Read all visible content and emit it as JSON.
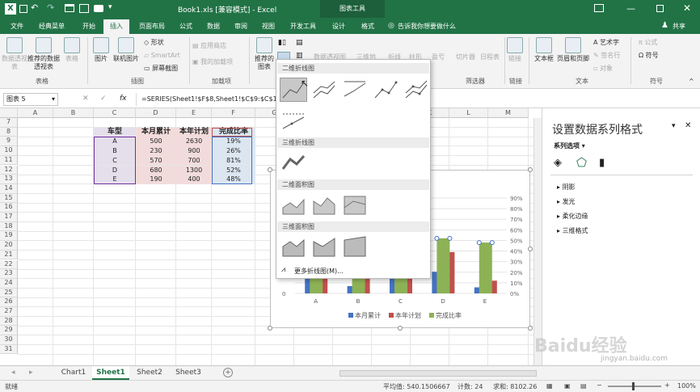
{
  "titlebar": {
    "title": "Book1.xls [兼容模式] - Excel",
    "context_tool": "图表工具"
  },
  "tabs": [
    "文件",
    "经典菜单",
    "开始",
    "插入",
    "页面布局",
    "公式",
    "数据",
    "审阅",
    "视图",
    "开发工具",
    "设计",
    "格式"
  ],
  "tell_me": "告诉我你想要做什么",
  "share": "共享",
  "ribbon": {
    "pivot": [
      "数据透视表",
      "推荐的数据透视表",
      "表格"
    ],
    "group_table": "表格",
    "illus": [
      "图片",
      "联机图片",
      "形状",
      "SmartArt",
      "屏幕截图"
    ],
    "group_illus": "插图",
    "addins": [
      "应用商店",
      "我的加载项"
    ],
    "group_addins": "加载项",
    "recommend_chart": "推荐的图表",
    "chart_items": [
      "数据透视图",
      "三维地图",
      "折线",
      "柱形",
      "盈亏",
      "切片器",
      "日程表",
      "链接",
      "文本框",
      "页眉和页脚",
      "艺术字",
      "签名行",
      "对象",
      "公式",
      "符号"
    ],
    "group_filter": "筛选器",
    "group_links": "链接",
    "group_text": "文本",
    "group_symbols": "符号"
  },
  "formula": {
    "namebox": "图表 5",
    "fx": "fx",
    "content": "=SERIES(Sheet1!$F$8,Sheet1!$C$9:$C$1"
  },
  "columns": [
    "A",
    "B",
    "C",
    "D",
    "E",
    "F",
    "G",
    "H",
    "I",
    "J",
    "K",
    "L",
    "M"
  ],
  "rows": [
    "7",
    "8",
    "9",
    "10",
    "11",
    "12",
    "13",
    "14",
    "15",
    "16",
    "17",
    "18",
    "19",
    "20",
    "21",
    "22",
    "23",
    "24",
    "25",
    "26",
    "27",
    "28",
    "29",
    "30",
    "31"
  ],
  "table": {
    "headers": [
      "车型",
      "本月累计",
      "本年计划",
      "完成比率"
    ],
    "rows": [
      [
        "A",
        "500",
        "2630",
        "19%"
      ],
      [
        "B",
        "230",
        "900",
        "26%"
      ],
      [
        "C",
        "570",
        "700",
        "81%"
      ],
      [
        "D",
        "680",
        "1300",
        "52%"
      ],
      [
        "E",
        "190",
        "400",
        "48%"
      ]
    ]
  },
  "dropdown": {
    "sec1": "二维折线图",
    "sec2": "三维折线图",
    "sec3": "二维面积图",
    "sec4": "三维面积图",
    "more": "更多折线图(M)..."
  },
  "chart_data": {
    "type": "bar",
    "categories": [
      "A",
      "B",
      "C",
      "D",
      "E"
    ],
    "series": [
      {
        "name": "本月累计",
        "values": [
          500,
          230,
          570,
          680,
          190
        ]
      },
      {
        "name": "本年计划",
        "values": [
          2630,
          900,
          700,
          1300,
          400
        ]
      },
      {
        "name": "完成比率",
        "values": [
          0.19,
          0.26,
          0.81,
          0.52,
          0.48
        ]
      }
    ],
    "secondary_ticks": [
      "0%",
      "10%",
      "20%",
      "30%",
      "40%",
      "50%",
      "60%",
      "70%",
      "80%",
      "90%"
    ],
    "primary_tick_zero": "0",
    "colors": {
      "本月累计": "#4472c4",
      "本年计划": "#c0504d",
      "完成比率": "#8db255"
    }
  },
  "pane": {
    "title": "设置数据系列格式",
    "options": "系列选项",
    "sections": [
      "阴影",
      "发光",
      "柔化边缘",
      "三维格式"
    ]
  },
  "sheets": [
    "Chart1",
    "Sheet1",
    "Sheet2",
    "Sheet3"
  ],
  "status": {
    "mode": "就绪",
    "avg": "平均值: 540.1506667",
    "count": "计数: 24",
    "sum": "求和: 8102.26",
    "zoom": "100%"
  },
  "watermark": {
    "brand": "Baidu经验",
    "url": "jingyan.baidu.com"
  }
}
